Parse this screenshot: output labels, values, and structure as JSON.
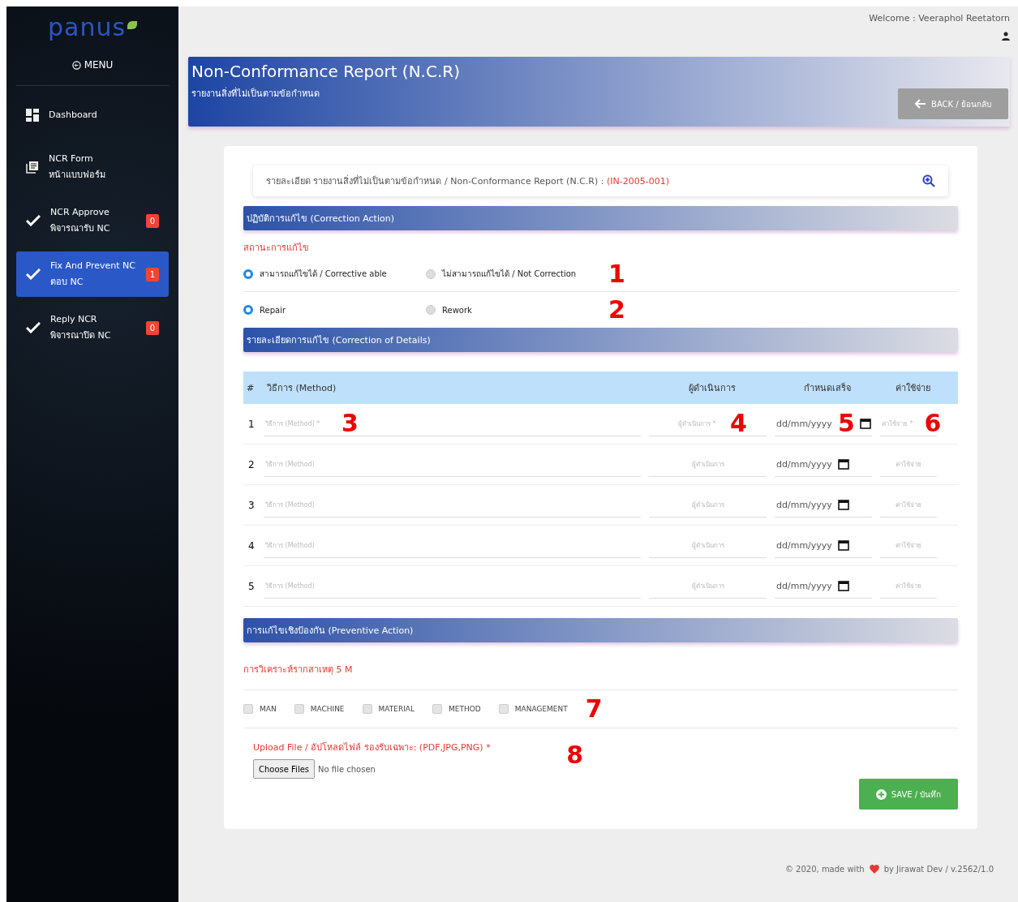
{
  "sidebar": {
    "logo": "panus",
    "menu_label": "MENU",
    "items": [
      {
        "kind": "dashboard",
        "lines": [
          "Dashboard"
        ],
        "selected": false
      },
      {
        "kind": "form",
        "lines": [
          "NCR Form",
          "หน้าแบบฟอร์ม"
        ],
        "selected": false
      },
      {
        "kind": "task",
        "lines": [
          "NCR Approve",
          "พิจารณารับ NC"
        ],
        "badge": "0",
        "selected": false
      },
      {
        "kind": "task",
        "lines": [
          "Fix And Prevent NC",
          "ตอบ NC"
        ],
        "badge": "1",
        "selected": true
      },
      {
        "kind": "task",
        "lines": [
          "Reply NCR",
          "พิจารณาปิด NC"
        ],
        "badge": "0",
        "selected": false
      }
    ]
  },
  "header": {
    "welcome": "Welcome : Veeraphol Reetatorn"
  },
  "banner": {
    "title": "Non-Conformance Report (N.C.R)",
    "subtitle": "รายงานสิ่งที่ไม่เป็นตามข้อกำหนด",
    "back_button": "BACK / ย้อนกลับ"
  },
  "details": {
    "text": "รายละเอียด รายงานสิ่งที่ไม่เป็นตามข้อกำหนด / Non-Conformance Report (N.C.R) :",
    "code": "(IN-2005-001)"
  },
  "correction": {
    "title": "ปฏิบัติการแก้ไข (Correction Action)",
    "status_label": "สถานะการแก้ไข",
    "groups": [
      {
        "annotation": "1",
        "options": [
          {
            "label": "สามารถแก้ไขได้ / Corrective able",
            "selected": true
          },
          {
            "label": "ไม่สามารถแก้ไขได้ / Not Correction",
            "selected": false
          }
        ]
      },
      {
        "annotation": "2",
        "options": [
          {
            "label": "Repair",
            "selected": true
          },
          {
            "label": "Rework",
            "selected": false
          }
        ]
      }
    ]
  },
  "details_section": {
    "title": "รายละเอียดการแก้ไข (Correction of Details)",
    "columns": [
      "#",
      "วิธีการ (Method)",
      "ผู้ดำเนินการ",
      "กำหนดเสร็จ",
      "ค่าใช้จ่าย"
    ],
    "rows": [
      {
        "number": "1",
        "method": {
          "placeholder": "วิธีการ (Method) *",
          "annotation": "3"
        },
        "operator": {
          "placeholder": "ผู้ดำเนินการ *",
          "annotation": "4"
        },
        "due": {
          "placeholder": "dd/mm/yyyy",
          "annotation": "5"
        },
        "cost": {
          "placeholder": "ค่าใช้จ่าย *",
          "annotation": "6"
        }
      },
      {
        "number": "2",
        "method": {
          "placeholder": "วิธีการ (Method)"
        },
        "operator": {
          "placeholder": "ผู้ดำเนินการ"
        },
        "due": {
          "placeholder": "dd/mm/yyyy"
        },
        "cost": {
          "placeholder": "ค่าใช้จ่าย"
        }
      },
      {
        "number": "3",
        "method": {
          "placeholder": "วิธีการ (Method)"
        },
        "operator": {
          "placeholder": "ผู้ดำเนินการ"
        },
        "due": {
          "placeholder": "dd/mm/yyyy"
        },
        "cost": {
          "placeholder": "ค่าใช้จ่าย"
        }
      },
      {
        "number": "4",
        "method": {
          "placeholder": "วิธีการ (Method)"
        },
        "operator": {
          "placeholder": "ผู้ดำเนินการ"
        },
        "due": {
          "placeholder": "dd/mm/yyyy"
        },
        "cost": {
          "placeholder": "ค่าใช้จ่าย"
        }
      },
      {
        "number": "5",
        "method": {
          "placeholder": "วิธีการ (Method)"
        },
        "operator": {
          "placeholder": "ผู้ดำเนินการ"
        },
        "due": {
          "placeholder": "dd/mm/yyyy"
        },
        "cost": {
          "placeholder": "ค่าใช้จ่าย"
        }
      }
    ]
  },
  "preventive": {
    "title": "การแก้ไขเชิงป้องกัน (Preventive Action)",
    "analysis_label": "การวิเคราะห์รากสาเหตุ 5 M",
    "annotation": "7",
    "checkboxes": [
      {
        "label": "MAN",
        "checked": false
      },
      {
        "label": "MACHINE",
        "checked": false
      },
      {
        "label": "MATERIAL",
        "checked": false
      },
      {
        "label": "METHOD",
        "checked": false
      },
      {
        "label": "MANAGEMENT",
        "checked": false
      }
    ]
  },
  "upload": {
    "label": "Upload File / อัปโหลดไฟล์ รองรับเฉพาะ: (PDF,JPG,PNG) *",
    "button": "Choose Files",
    "status": "No file chosen",
    "annotation": "8"
  },
  "save_button": "SAVE / บันทึก",
  "footer": {
    "before": "© 2020, made with",
    "after": "by Jirawat Dev / v.2562/1.0"
  }
}
